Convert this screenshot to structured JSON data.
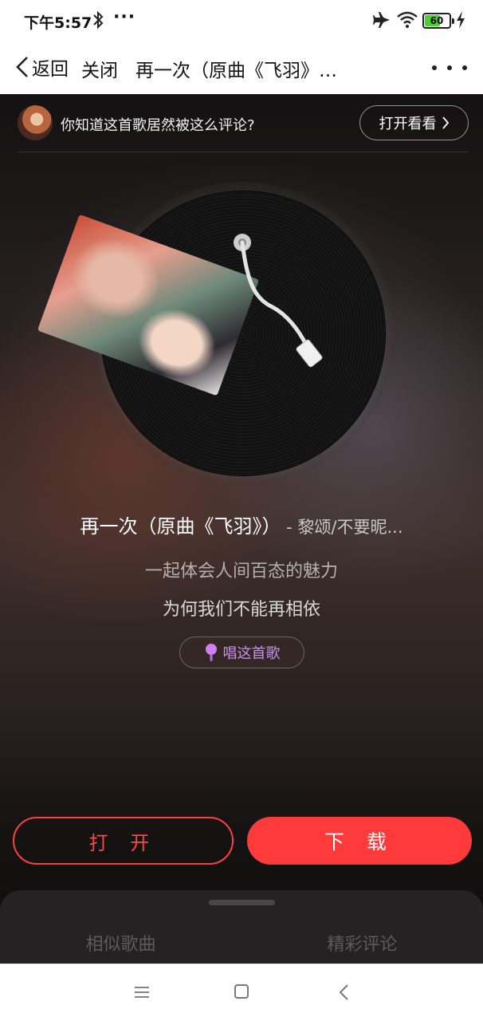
{
  "status_bar": {
    "time": "下午5:57",
    "dots": "···",
    "battery": "60",
    "battery_fraction": 0.6,
    "battery_color": "#4cd02e"
  },
  "nav": {
    "back_label": "返回",
    "close_label": "关闭",
    "title": "再一次（原曲《飞羽》…",
    "icons": [
      "chevron-left-icon",
      "more-icon"
    ]
  },
  "banner": {
    "text": "你知道这首歌居然被这么评论?",
    "button_label": "打开看看"
  },
  "song": {
    "title": "再一次（原曲《飞羽》）",
    "artist": " - 黎颂/不要昵...",
    "lyric_current": "一起体会人间百态的魅力",
    "lyric_next": "为何我们不能再相依"
  },
  "sing_button": {
    "label": "唱这首歌",
    "color": "#c891f0"
  },
  "actions": {
    "open_label": "打 开",
    "download_label": "下 载",
    "accent_color": "#ff3a3a"
  },
  "tabs": {
    "similar": "相似歌曲",
    "comments": "精彩评论"
  }
}
